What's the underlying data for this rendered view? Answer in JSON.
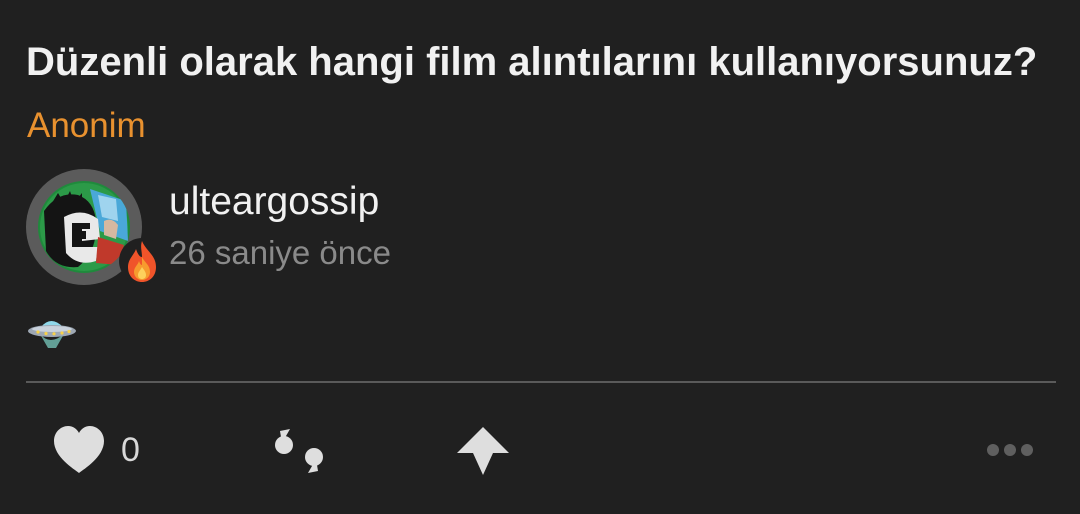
{
  "post": {
    "question": "Düzenli olarak hangi film alıntılarını kullanıyorsunuz?",
    "asker": "Anonim",
    "author": {
      "username": "ulteargossip",
      "time_ago": "26 saniye önce",
      "avatar_icon": "user-avatar",
      "badge_icon": "fire-icon"
    },
    "body_emoji": "flying-saucer-icon"
  },
  "actions": {
    "like_count": "0",
    "like_icon": "heart-icon",
    "quote_icon": "quote-icon",
    "upvote_icon": "upvote-arrow-icon",
    "more_icon": "more-dots-icon"
  },
  "colors": {
    "background": "#202020",
    "accent": "#e8912f",
    "text": "#f1f1f1",
    "muted": "#8a8a8a",
    "icon": "#dedede"
  }
}
